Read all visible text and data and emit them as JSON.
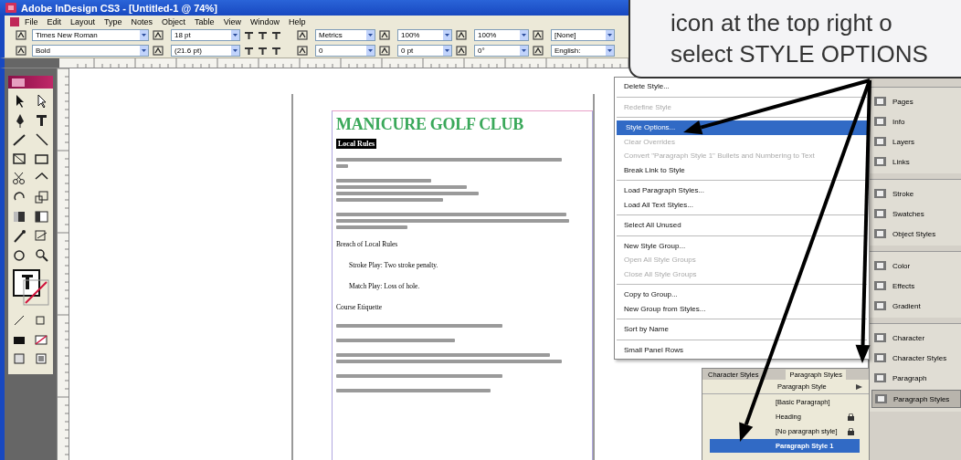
{
  "window": {
    "title": "Adobe InDesign CS3 - [Untitled-1 @ 74%]"
  },
  "menu_bar": [
    "File",
    "Edit",
    "Layout",
    "Type",
    "Notes",
    "Object",
    "Table",
    "View",
    "Window",
    "Help"
  ],
  "control_panel": {
    "font_family": "Times New Roman",
    "font_style": "Bold",
    "font_size": "18 pt",
    "leading": "(21.6 pt)",
    "kerning": "Metrics",
    "tracking": "0",
    "vertical_scale": "100%",
    "horizontal_scale": "100%",
    "baseline_shift": "0 pt",
    "skew": "0°",
    "character_style": "[None]",
    "language": "English:"
  },
  "document": {
    "heading": "MANICURE GOLF CLUB",
    "subheading": "Local Rules",
    "blocks": [
      {
        "kind": "illegible"
      },
      {
        "kind": "illegible"
      },
      {
        "kind": "illegible"
      },
      {
        "kind": "text",
        "text": "Breach of Local Rules"
      },
      {
        "kind": "text",
        "text": "Stroke Play:  Two stroke penalty."
      },
      {
        "kind": "text",
        "text": "Match Play:  Loss of hole."
      },
      {
        "kind": "text",
        "text": "Course Etiquette"
      },
      {
        "kind": "illegible"
      },
      {
        "kind": "illegible"
      },
      {
        "kind": "illegible"
      },
      {
        "kind": "illegible"
      },
      {
        "kind": "illegible"
      }
    ]
  },
  "flyout_menu": {
    "items": [
      {
        "kind": "item",
        "label": "Delete Style...",
        "selected": false,
        "disabled": false
      },
      {
        "kind": "separator"
      },
      {
        "kind": "item",
        "label": "Redefine Style",
        "selected": false,
        "disabled": true
      },
      {
        "kind": "separator"
      },
      {
        "kind": "item",
        "label": "Style Options...",
        "selected": true,
        "disabled": false
      },
      {
        "kind": "item",
        "label": "Clear Overrides",
        "selected": false,
        "disabled": true
      },
      {
        "kind": "item",
        "label": "Convert \"Paragraph Style 1\" Bullets and Numbering to Text",
        "selected": false,
        "disabled": true
      },
      {
        "kind": "item",
        "label": "Break Link to Style",
        "selected": false,
        "disabled": false
      },
      {
        "kind": "separator"
      },
      {
        "kind": "item",
        "label": "Load Paragraph Styles...",
        "selected": false,
        "disabled": false
      },
      {
        "kind": "item",
        "label": "Load All Text Styles...",
        "selected": false,
        "disabled": false
      },
      {
        "kind": "separator"
      },
      {
        "kind": "item",
        "label": "Select All Unused",
        "selected": false,
        "disabled": false
      },
      {
        "kind": "separator"
      },
      {
        "kind": "item",
        "label": "New Style Group...",
        "selected": false,
        "disabled": false
      },
      {
        "kind": "item",
        "label": "Open All Style Groups",
        "selected": false,
        "disabled": true
      },
      {
        "kind": "item",
        "label": "Close All Style Groups",
        "selected": false,
        "disabled": true
      },
      {
        "kind": "separator"
      },
      {
        "kind": "item",
        "label": "Copy to Group...",
        "selected": false,
        "disabled": false
      },
      {
        "kind": "item",
        "label": "New Group from Styles...",
        "selected": false,
        "disabled": false
      },
      {
        "kind": "separator"
      },
      {
        "kind": "item",
        "label": "Sort by Name",
        "selected": false,
        "disabled": false
      },
      {
        "kind": "separator"
      },
      {
        "kind": "item",
        "label": "Small Panel Rows",
        "selected": false,
        "disabled": false
      }
    ]
  },
  "paragraph_styles_panel": {
    "tabs": [
      {
        "label": "Character Styles",
        "selected": false
      },
      {
        "label": "Paragraph Styles",
        "selected": true
      }
    ],
    "current_style": "Paragraph Style",
    "styles": [
      {
        "label": "[Basic Paragraph]",
        "selected": false,
        "locked": false
      },
      {
        "label": "Heading",
        "selected": false,
        "locked": true
      },
      {
        "label": "[No paragraph style]",
        "selected": false,
        "locked": true
      },
      {
        "label": "Paragraph Style 1",
        "selected": true,
        "locked": false
      }
    ]
  },
  "panel_dock": {
    "groups": [
      [
        {
          "label": "Pages",
          "selected": false
        },
        {
          "label": "Info",
          "selected": false
        },
        {
          "label": "Layers",
          "selected": false
        },
        {
          "label": "Links",
          "selected": false
        }
      ],
      [
        {
          "label": "Stroke",
          "selected": false
        },
        {
          "label": "Swatches",
          "selected": false
        },
        {
          "label": "Object Styles",
          "selected": false
        }
      ],
      [
        {
          "label": "Color",
          "selected": false
        },
        {
          "label": "Effects",
          "selected": false
        },
        {
          "label": "Gradient",
          "selected": false
        }
      ],
      [
        {
          "label": "Character",
          "selected": false
        },
        {
          "label": "Character Styles",
          "selected": false
        },
        {
          "label": "Paragraph",
          "selected": false
        },
        {
          "label": "Paragraph Styles",
          "selected": true
        }
      ]
    ]
  },
  "callout": {
    "lines": [
      "icon at the top right o",
      "select STYLE OPTIONS"
    ]
  }
}
